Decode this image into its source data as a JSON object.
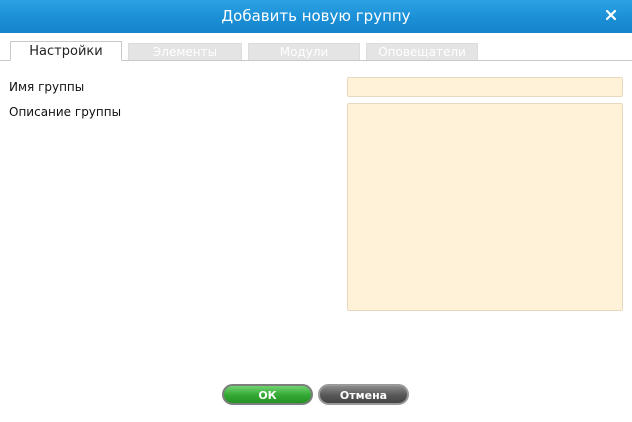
{
  "dialog": {
    "title": "Добавить новую группу",
    "close_icon": "close-icon"
  },
  "tabs": [
    {
      "label": "Настройки",
      "active": true
    },
    {
      "label": "Элементы",
      "active": false
    },
    {
      "label": "Модули",
      "active": false
    },
    {
      "label": "Оповещатели",
      "active": false
    }
  ],
  "form": {
    "group_name_label": "Имя группы",
    "group_name_value": "",
    "description_label": "Описание группы",
    "description_value": ""
  },
  "buttons": {
    "ok_label": "ОК",
    "cancel_label": "Отмена"
  },
  "colors": {
    "titlebar": "#1b8fd6",
    "field_bg": "#fff2d9",
    "ok_button": "#33a833",
    "cancel_button": "#575757"
  }
}
